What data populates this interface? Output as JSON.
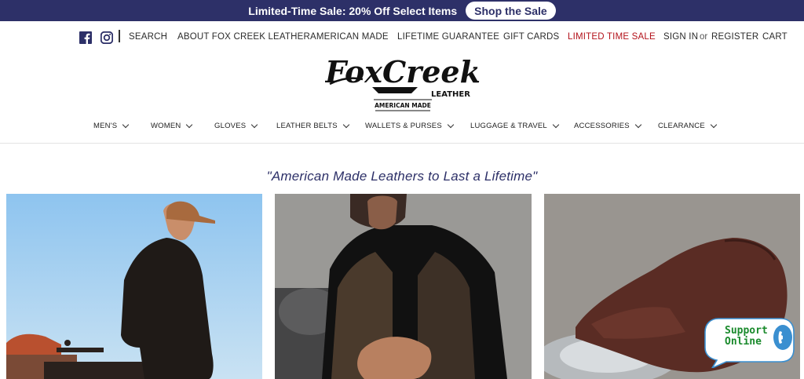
{
  "promo": {
    "text": "Limited-Time Sale: 20% Off Select Items",
    "button": "Shop the Sale"
  },
  "utility_nav": {
    "search": "SEARCH",
    "about": "ABOUT FOX CREEK LEATHER",
    "american_made": "AMERICAN MADE",
    "guarantee": "LIFETIME GUARANTEE",
    "gift_cards": "GIFT CARDS",
    "sale": "LIMITED TIME SALE",
    "sign_in": "SIGN IN",
    "or": "or",
    "register": "REGISTER",
    "cart": "CART"
  },
  "logo": {
    "line1": "FoxCreek",
    "line2": "LEATHER",
    "line3": "AMERICAN MADE"
  },
  "main_nav": {
    "mens": "MEN'S",
    "women": "WOMEN",
    "gloves": "GLOVES",
    "belts": "LEATHER BELTS",
    "wallets": "WALLETS & PURSES",
    "luggage": "LUGGAGE & TRAVEL",
    "accessories": "ACCESSORIES",
    "clearance": "CLEARANCE"
  },
  "tagline": "\"American Made Leathers to Last a Lifetime\"",
  "support": {
    "line1": "Support",
    "line2": "Online"
  },
  "colors": {
    "brand_navy": "#2d3068",
    "sale_red": "#b3121b",
    "support_green": "#1a8a2c"
  },
  "icons": [
    "facebook-icon",
    "instagram-icon",
    "chevron-down-icon",
    "phone-icon"
  ]
}
